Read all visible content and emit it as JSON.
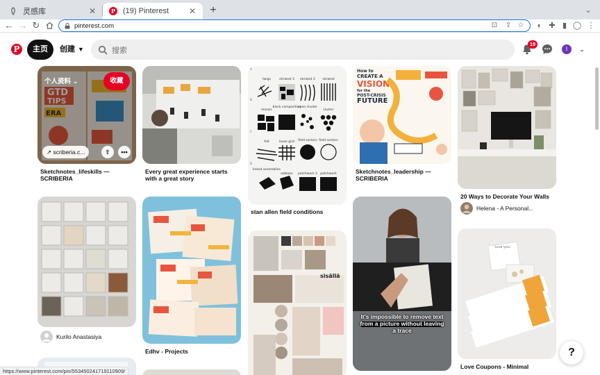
{
  "browser": {
    "tabs": [
      {
        "title": "灵感库",
        "active": false
      },
      {
        "title": "(19) Pinterest",
        "active": true
      }
    ],
    "new_tab_label": "+",
    "url": "pinterest.com",
    "status_url": "https://www.pinterest.com/pin/553450241719110909/"
  },
  "header": {
    "logo_glyph": "P",
    "home_label": "主页",
    "create_label": "创建",
    "search_placeholder": "搜索",
    "notification_count": "19",
    "avatar_initial": "I",
    "brand_color": "#e60023"
  },
  "overlay": {
    "board_label": "个人资料",
    "save_label": "收藏",
    "link_text": "scriberia.c..."
  },
  "pins": [
    {
      "title": "Sketchnotes_lifeskills — SCRIBERIA",
      "author": ""
    },
    {
      "title": "Every great experience starts with a great story",
      "author": ""
    },
    {
      "title": "stan allen field conditions",
      "author": ""
    },
    {
      "title": "Sketchnotes_leadership — SCRIBERIA",
      "author": ""
    },
    {
      "title": "20 Ways to Decorate Your Walls",
      "author": "Helena - A Personal..."
    },
    {
      "title": "",
      "author": "Kurilo Anastasiya"
    },
    {
      "title": "Edhv - Projects",
      "author": ""
    },
    {
      "title": "",
      "author": ""
    },
    {
      "title": "",
      "author": ""
    },
    {
      "title": "Love Coupons - Minimal",
      "author": ""
    }
  ],
  "image_texts": {
    "sketch1": [
      "GTD",
      "TIPS",
      "ERA"
    ],
    "vision": [
      "How to",
      "CREATE A",
      "VISION",
      "for the",
      "POST-CRISIS",
      "FUTURE"
    ],
    "field_labels": [
      "twigs",
      "striated 3",
      "striated 2",
      "striated",
      "mosaic",
      "block composition",
      "open cluster",
      "cluster",
      "felt",
      "loose grid",
      "field sectors",
      "field sectors",
      "linked assemblies",
      "oxbloon",
      "patchwork 2",
      "patchwork"
    ],
    "field_cols": [
      "A",
      "B",
      "C",
      "D"
    ],
    "moodboard": [
      "sisällä"
    ],
    "office_caption": "It's impossible to remove text from a picture without leaving a trace",
    "coupons": [
      "love you"
    ],
    "help": "?"
  }
}
